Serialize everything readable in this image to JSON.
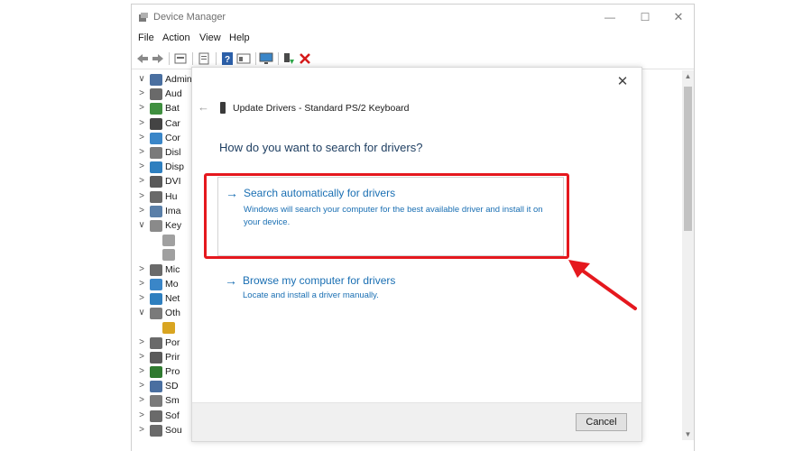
{
  "window": {
    "title": "Device Manager",
    "controls": {
      "minimize": "—",
      "maximize": "☐",
      "close": "✕"
    }
  },
  "menu": [
    "File",
    "Action",
    "View",
    "Help"
  ],
  "toolbar": {
    "icons": [
      "back-icon",
      "forward-icon",
      "properties-icon",
      "show-hidden-icon",
      "help-icon",
      "view-icon",
      "monitor-icon",
      "update-driver-icon",
      "uninstall-icon"
    ]
  },
  "tree": {
    "items": [
      {
        "chevron": "∨",
        "label": "Admin",
        "icon": "computer-icon",
        "color": "#4a6fa0"
      },
      {
        "chevron": ">",
        "label": "Aud",
        "icon": "speaker-icon",
        "color": "#6a6a6a"
      },
      {
        "chevron": ">",
        "label": "Bat",
        "icon": "battery-icon",
        "color": "#3f8f3f"
      },
      {
        "chevron": ">",
        "label": "Car",
        "icon": "camera-icon",
        "color": "#444444"
      },
      {
        "chevron": ">",
        "label": "Cor",
        "icon": "computer-icon",
        "color": "#3a86c8"
      },
      {
        "chevron": ">",
        "label": "Disl",
        "icon": "disk-icon",
        "color": "#7a7a7a"
      },
      {
        "chevron": ">",
        "label": "Disp",
        "icon": "display-icon",
        "color": "#2e7fbf"
      },
      {
        "chevron": ">",
        "label": "DVI",
        "icon": "dvd-icon",
        "color": "#5a5a5a"
      },
      {
        "chevron": ">",
        "label": "Hu",
        "icon": "hid-icon",
        "color": "#6a6a6a"
      },
      {
        "chevron": ">",
        "label": "Ima",
        "icon": "imaging-icon",
        "color": "#5a7fa8"
      },
      {
        "chevron": "∨",
        "label": "Key",
        "icon": "keyboard-icon",
        "color": "#8a8a8a"
      },
      {
        "chevron": "",
        "label": "",
        "icon": "keyboard-icon",
        "color": "#a0a0a0"
      },
      {
        "chevron": "",
        "label": "",
        "icon": "keyboard-icon",
        "color": "#a0a0a0"
      },
      {
        "chevron": ">",
        "label": "Mic",
        "icon": "mouse-icon",
        "color": "#6a6a6a"
      },
      {
        "chevron": ">",
        "label": "Mo",
        "icon": "monitor-icon",
        "color": "#3a86c8"
      },
      {
        "chevron": ">",
        "label": "Net",
        "icon": "network-icon",
        "color": "#2e7fbf"
      },
      {
        "chevron": "∨",
        "label": "Oth",
        "icon": "other-device-icon",
        "color": "#7a7a7a"
      },
      {
        "chevron": "",
        "label": "",
        "icon": "warning-device-icon",
        "color": "#d9a521"
      },
      {
        "chevron": ">",
        "label": "Por",
        "icon": "port-icon",
        "color": "#6a6a6a"
      },
      {
        "chevron": ">",
        "label": "Prir",
        "icon": "printer-icon",
        "color": "#5a5a5a"
      },
      {
        "chevron": ">",
        "label": "Pro",
        "icon": "processor-icon",
        "color": "#2f7a2f"
      },
      {
        "chevron": ">",
        "label": "SD",
        "icon": "sd-icon",
        "color": "#4a6fa0"
      },
      {
        "chevron": ">",
        "label": "Sm",
        "icon": "sensor-icon",
        "color": "#7a7a7a"
      },
      {
        "chevron": ">",
        "label": "Sof",
        "icon": "software-icon",
        "color": "#6a6a6a"
      },
      {
        "chevron": ">",
        "label": "Sou",
        "icon": "sound-icon",
        "color": "#6a6a6a"
      }
    ]
  },
  "dialog": {
    "title": "Update Drivers - Standard PS/2 Keyboard",
    "heading": "How do you want to search for drivers?",
    "option_auto": {
      "arrow": "→",
      "title": "Search automatically for drivers",
      "desc": "Windows will search your computer for the best available driver and install it on your device."
    },
    "option_browse": {
      "arrow": "→",
      "title": "Browse my computer for drivers",
      "desc": "Locate and install a driver manually."
    },
    "cancel_label": "Cancel",
    "close_glyph": "✕",
    "back_glyph": "←"
  },
  "scrollbar": {
    "up": "▲",
    "down": "▼"
  },
  "colors": {
    "link_blue": "#1a6fb3",
    "heading_blue": "#1f3f62",
    "highlight_red": "#e5181e"
  }
}
